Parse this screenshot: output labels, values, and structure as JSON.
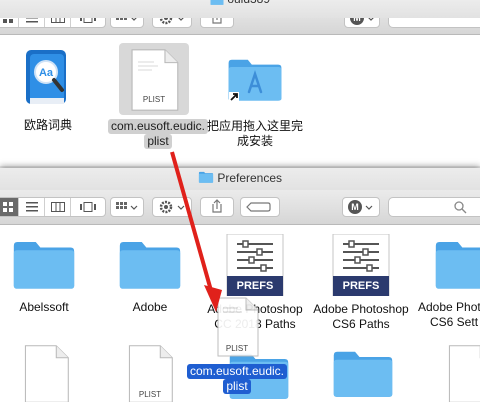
{
  "window_top": {
    "title": "ould389",
    "items": [
      {
        "label": "欧路词典"
      },
      {
        "label_lines": [
          "com.eusoft.eudic.",
          "plist"
        ],
        "badge": "PLIST"
      },
      {
        "label_lines": [
          "把应用拖入这里完",
          "成安装"
        ]
      }
    ]
  },
  "window_bottom": {
    "title": "Preferences",
    "items": [
      {
        "label": "Abelssoft"
      },
      {
        "label": "Adobe"
      },
      {
        "label_lines": [
          "Adobe Photoshop",
          "CC 2018 Paths"
        ],
        "badge": "PREFS"
      },
      {
        "label_lines": [
          "Adobe Photoshop",
          "CS6 Paths"
        ],
        "badge": "PREFS"
      },
      {
        "label_lines": [
          "Adobe Photo",
          "CS6 Sett"
        ]
      }
    ],
    "row2": {
      "plist_badge": "PLIST"
    }
  },
  "drag_ghost": {
    "badge": "PLIST",
    "label_lines": [
      "com.eusoft.eudic.",
      "plist"
    ]
  },
  "colors": {
    "folder": "#5cb2ee",
    "selection": "#1f5ed1",
    "arrow": "#e0211b",
    "prefs": "#2b3a6e"
  }
}
